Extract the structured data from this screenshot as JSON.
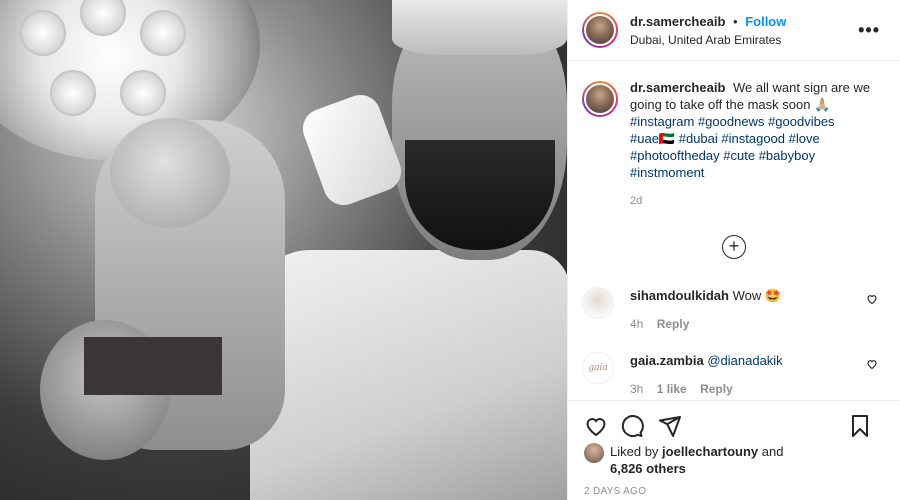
{
  "post": {
    "username": "dr.samercheaib",
    "follow_label": "Follow",
    "separator": "•",
    "location": "Dubai, United Arab Emirates",
    "more_label": "•••"
  },
  "caption": {
    "username": "dr.samercheaib",
    "text": "We all want sign are we going to take off the mask soon",
    "emoji": "🙏🏼",
    "hashtags": [
      "#instagram",
      "#goodnews",
      "#goodvibes",
      "#uae",
      "#dubai",
      "#instagood",
      "#love",
      "#photooftheday",
      "#cute",
      "#babyboy",
      "#instmoment"
    ],
    "flag_emoji": "🇦🇪",
    "time": "2d"
  },
  "load_more_label": "+",
  "comments": [
    {
      "username": "sihamdoulkidah",
      "text": "Wow",
      "emoji": "🤩",
      "time": "4h",
      "reply_label": "Reply"
    },
    {
      "username": "gaia.zambia",
      "text": "@dianadakik",
      "time": "3h",
      "likes": "1 like",
      "reply_label": "Reply",
      "avatar_text": "gaia"
    }
  ],
  "likes": {
    "prefix": "Liked by",
    "user": "joellechartouny",
    "conj": "and",
    "count": "6,826 others"
  },
  "posted_ago": "2 DAYS AGO",
  "icons": [
    "heart-icon",
    "comment-icon",
    "share-icon",
    "bookmark-icon",
    "plus-circle-icon",
    "more-icon"
  ],
  "colors": {
    "link": "#0095f6",
    "hashtag": "#00376b",
    "muted": "#8e8e8e"
  }
}
